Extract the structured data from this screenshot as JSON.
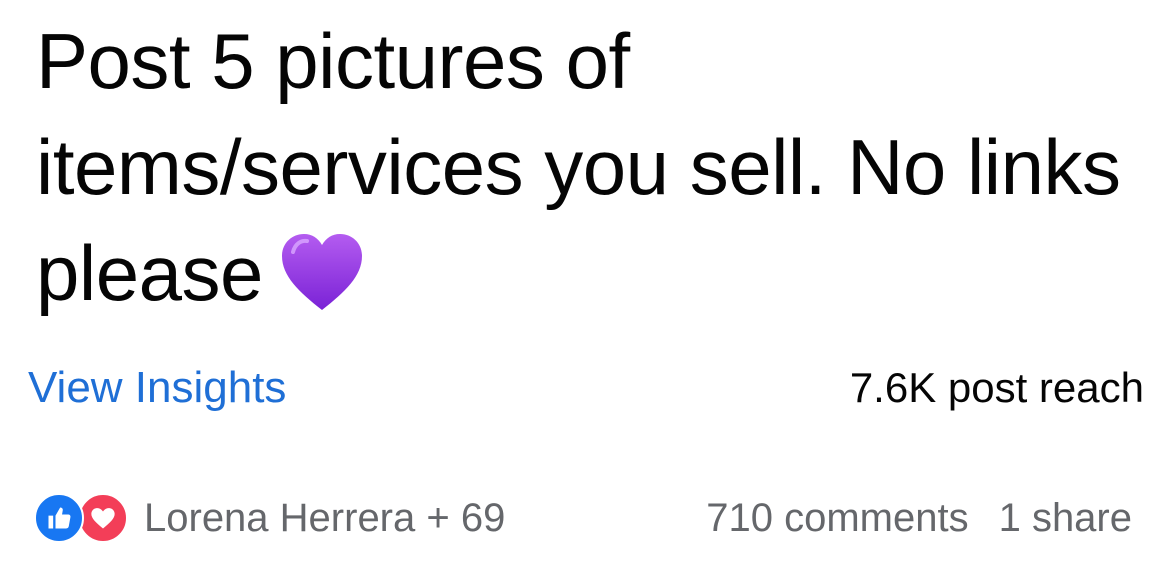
{
  "post": {
    "text": "Post 5 pictures of items/services you sell. No links please",
    "emoji": "purple-heart"
  },
  "insights": {
    "link_label": "View Insights",
    "reach_text": "7.6K post reach"
  },
  "footer": {
    "reactions_text": "Lorena Herrera + 69",
    "comments_text": "710 comments",
    "shares_text": "1 share",
    "reaction_icons": [
      "like-icon",
      "love-icon"
    ]
  },
  "colors": {
    "link": "#1f6fd6",
    "like": "#1877f2",
    "love": "#f33e58",
    "heart_emoji": "#9b40e6",
    "muted_text": "#65676b"
  }
}
